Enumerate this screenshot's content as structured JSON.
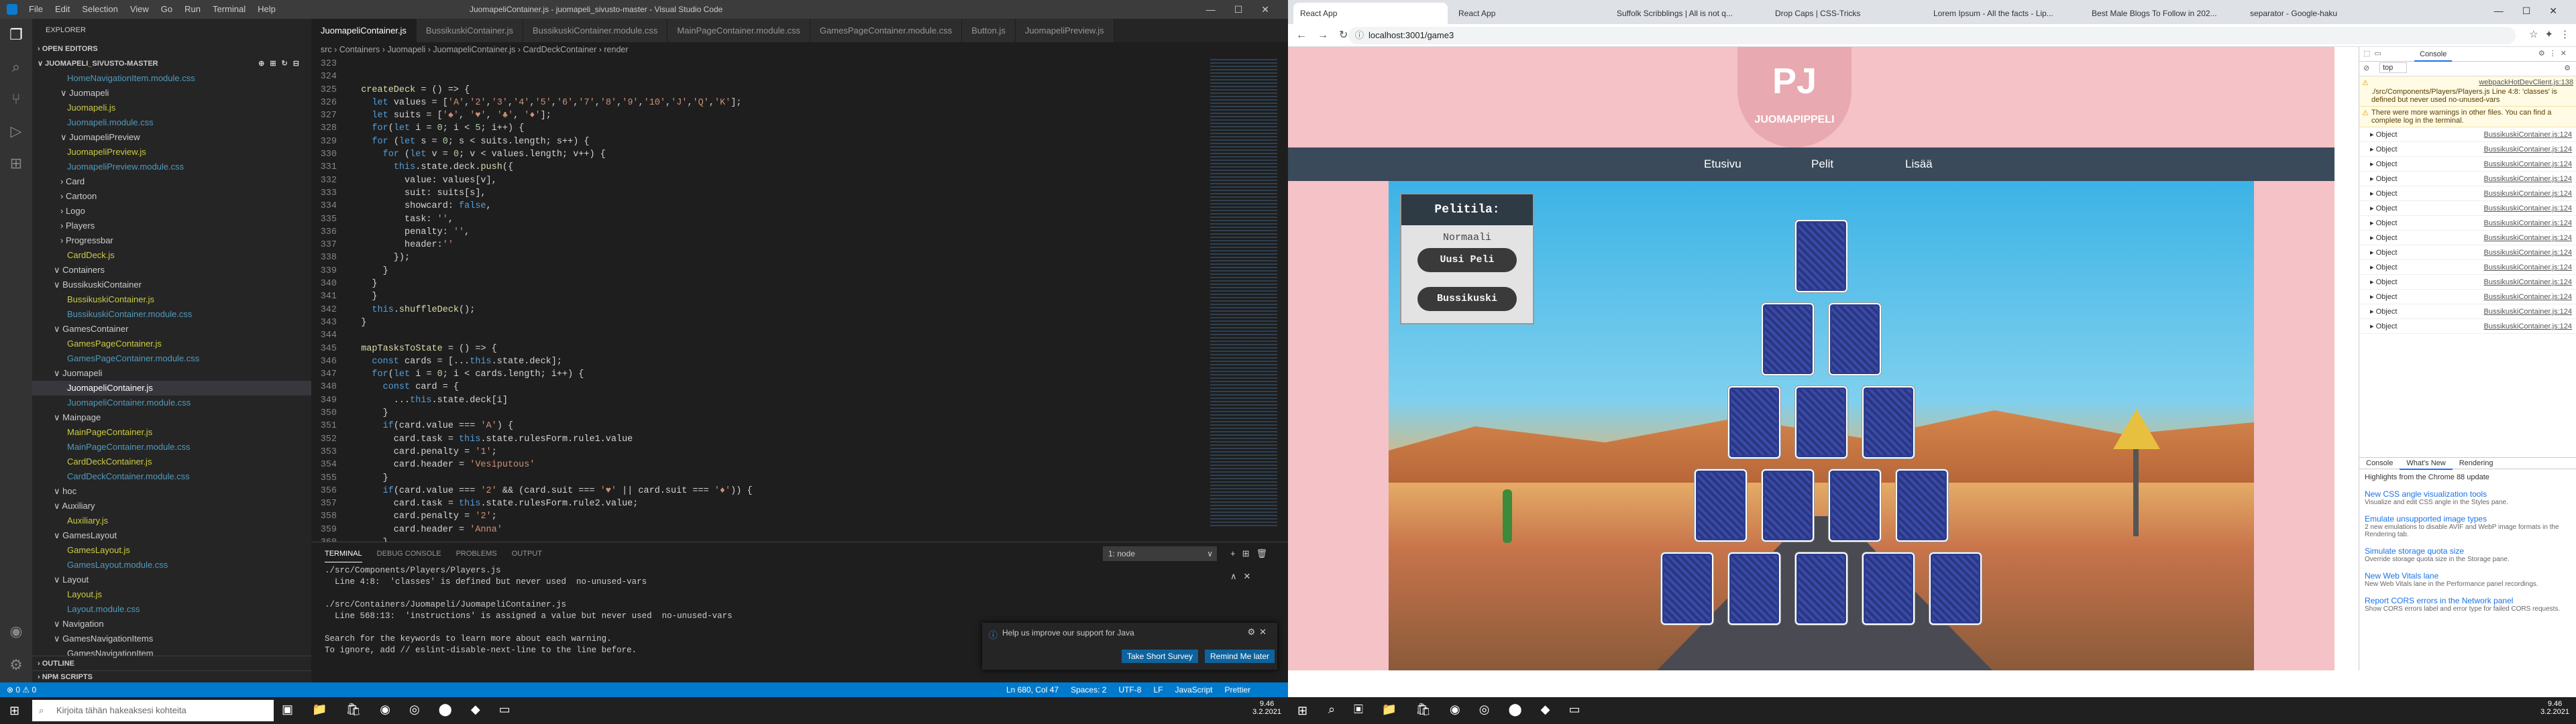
{
  "vscode": {
    "title": "JuomapeliContainer.js - juomapeli_sivusto-master - Visual Studio Code",
    "menu": [
      "File",
      "Edit",
      "Selection",
      "View",
      "Go",
      "Run",
      "Terminal",
      "Help"
    ],
    "explorer_title": "EXPLORER",
    "open_editors": "OPEN EDITORS",
    "project": "JUOMAPELI_SIVUSTO-MASTER",
    "tree": [
      "HomeNavigationItem.module.css",
      "∨ Juomapeli",
      "Juomapeli.js",
      "Juomapeli.module.css",
      "∨ JuomapeliPreview",
      "JuomapeliPreview.js",
      "JuomapeliPreview.module.css",
      "› Card",
      "› Cartoon",
      "› Logo",
      "› Players",
      "› Progressbar",
      "CardDeck.js",
      "∨ Containers",
      "∨ BussikuskiContainer",
      "BussikuskiContainer.js",
      "BussikuskiContainer.module.css",
      "∨ GamesContainer",
      "GamesPageContainer.js",
      "GamesPageContainer.module.css",
      "∨ Juomapeli",
      "JuomapeliContainer.js",
      "JuomapeliContainer.module.css",
      "∨ Mainpage",
      "MainPageContainer.js",
      "MainPageContainer.module.css",
      "CardDeckContainer.js",
      "CardDeckContainer.module.css",
      "∨ hoc",
      "∨ Auxiliary",
      "Auxiliary.js",
      "∨ GamesLayout",
      "GamesLayout.js",
      "GamesLayout.module.css",
      "∨ Layout",
      "Layout.js",
      "Layout.module.css",
      "∨ Navigation",
      "∨ GamesNavigationItems",
      "GamesNavigationItem"
    ],
    "outline": "OUTLINE",
    "npm": "NPM SCRIPTS",
    "tabs": [
      "JuomapeliContainer.js",
      "BussikuskiContainer.js",
      "BussikuskiContainer.module.css",
      "MainPageContainer.module.css",
      "GamesPageContainer.module.css",
      "Button.js",
      "JuomapeliPreview.js"
    ],
    "breadcrumb": "src › Containers › Juomapeli › JuomapeliContainer.js › CardDeckContainer › render",
    "code": [
      {
        "n": "323",
        "t": ""
      },
      {
        "n": "324",
        "t": ""
      },
      {
        "n": "325",
        "t": "  createDeck = () => {"
      },
      {
        "n": "326",
        "t": "    let values = ['A','2','3','4','5','6','7','8','9','10','J','Q','K'];"
      },
      {
        "n": "327",
        "t": "    let suits = ['♠', '♥', '♣', '♦'];"
      },
      {
        "n": "328",
        "t": "    for(let i = 0; i < 5; i++) {"
      },
      {
        "n": "329",
        "t": "    for (let s = 0; s < suits.length; s++) {"
      },
      {
        "n": "330",
        "t": "      for (let v = 0; v < values.length; v++) {"
      },
      {
        "n": "331",
        "t": "        this.state.deck.push({"
      },
      {
        "n": "332",
        "t": "          value: values[v],"
      },
      {
        "n": "333",
        "t": "          suit: suits[s],"
      },
      {
        "n": "334",
        "t": "          showcard: false,"
      },
      {
        "n": "335",
        "t": "          task: '',"
      },
      {
        "n": "336",
        "t": "          penalty: '',"
      },
      {
        "n": "337",
        "t": "          header:''"
      },
      {
        "n": "338",
        "t": "        });"
      },
      {
        "n": "339",
        "t": "      }"
      },
      {
        "n": "340",
        "t": "    }"
      },
      {
        "n": "341",
        "t": "    }"
      },
      {
        "n": "342",
        "t": "    this.shuffleDeck();"
      },
      {
        "n": "343",
        "t": "  }"
      },
      {
        "n": "344",
        "t": ""
      },
      {
        "n": "345",
        "t": "  mapTasksToState = () => {"
      },
      {
        "n": "346",
        "t": "    const cards = [...this.state.deck];"
      },
      {
        "n": "347",
        "t": "    for(let i = 0; i < cards.length; i++) {"
      },
      {
        "n": "348",
        "t": "      const card = {"
      },
      {
        "n": "349",
        "t": "        ...this.state.deck[i]"
      },
      {
        "n": "350",
        "t": "      }"
      },
      {
        "n": "351",
        "t": "      if(card.value === 'A') {"
      },
      {
        "n": "352",
        "t": "        card.task = this.state.rulesForm.rule1.value"
      },
      {
        "n": "353",
        "t": "        card.penalty = '1';"
      },
      {
        "n": "354",
        "t": "        card.header = 'Vesiputous'"
      },
      {
        "n": "355",
        "t": "      }"
      },
      {
        "n": "356",
        "t": "      if(card.value === '2' && (card.suit === '♥' || card.suit === '♦')) {"
      },
      {
        "n": "357",
        "t": "        card.task = this.state.rulesForm.rule2.value;"
      },
      {
        "n": "358",
        "t": "        card.penalty = '2';"
      },
      {
        "n": "359",
        "t": "        card.header = 'Anna'"
      },
      {
        "n": "360",
        "t": "      }"
      }
    ],
    "terminal_tabs": [
      "TERMINAL",
      "DEBUG CONSOLE",
      "PROBLEMS",
      "OUTPUT"
    ],
    "terminal_select": "1: node",
    "terminal_lines": [
      "./src/Components/Players/Players.js",
      "  Line 4:8:  'classes' is defined but never used  no-unused-vars",
      "",
      "./src/Containers/Juomapeli/JuomapeliContainer.js",
      "  Line 568:13:  'instructions' is assigned a value but never used  no-unused-vars",
      "",
      "Search for the keywords to learn more about each warning.",
      "To ignore, add // eslint-disable-next-line to the line before."
    ],
    "notification": {
      "text": "Help us improve our support for Java",
      "btn1": "Take Short Survey",
      "btn2": "Remind Me later"
    },
    "status_left": "⊗ 0 ⚠ 0",
    "status_right": [
      "Ln 680, Col 47",
      "Spaces: 2",
      "UTF-8",
      "LF",
      "JavaScript",
      "Prettier"
    ]
  },
  "taskbar_left": {
    "search": "Kirjoita tähän hakeaksesi kohteita",
    "time": "9.46",
    "date": "3.2.2021"
  },
  "chrome": {
    "tabs": [
      "React App",
      "React App",
      "Suffolk Scribblings | All is not q...",
      "Drop Caps | CSS-Tricks",
      "Lorem Ipsum - All the facts - Lip...",
      "Best Male Blogs To Follow in 202...",
      "separator - Google-haku"
    ],
    "url": "localhost:3001/game3"
  },
  "app": {
    "logo_text": "JUOMAPIPPELI",
    "logo_mark": "PJ",
    "nav": [
      "Etusivu",
      "Pelit",
      "Lisää"
    ],
    "panel_title": "Pelitila:",
    "mode": "Normaali",
    "btn_new": "Uusi Peli",
    "btn_bussi": "Bussikuski"
  },
  "devtools": {
    "tabs": [
      "Console"
    ],
    "context": "top",
    "warn1": "./src/Components/Players/Players.js  Line 4:8:  'classes' is defined but never used  no-unused-vars",
    "warn2": "There were more warnings in other files. You can find a complete log in the terminal.",
    "warn_src": "webpackHotDevClient.js:138",
    "objects_src": "BussikuskiContainer.js:124",
    "object_label": "▸ Object",
    "drawer_tabs": [
      "Console",
      "What's New",
      "Rendering"
    ],
    "highlights": "Highlights from the Chrome 88 update",
    "news": [
      {
        "title": "New CSS angle visualization tools",
        "desc": "Visualize and edit CSS angle in the Styles pane."
      },
      {
        "title": "Emulate unsupported image types",
        "desc": "2 new emulations to disable AVIF and WebP image formats in the Rendering tab."
      },
      {
        "title": "Simulate storage quota size",
        "desc": "Override storage quota size in the Storage pane."
      },
      {
        "title": "New Web Vitals lane",
        "desc": "New Web Vitals lane in the Performance panel recordings."
      },
      {
        "title": "Report CORS errors in the Network panel",
        "desc": "Show CORS errors label and error type for failed CORS requests."
      }
    ]
  },
  "taskbar_right": {
    "time": "9.46",
    "date": "3.2.2021"
  },
  "colors": {
    "accent": "#007acc",
    "app_nav": "#3a4a5a",
    "card_back": "#2c3e8f"
  }
}
